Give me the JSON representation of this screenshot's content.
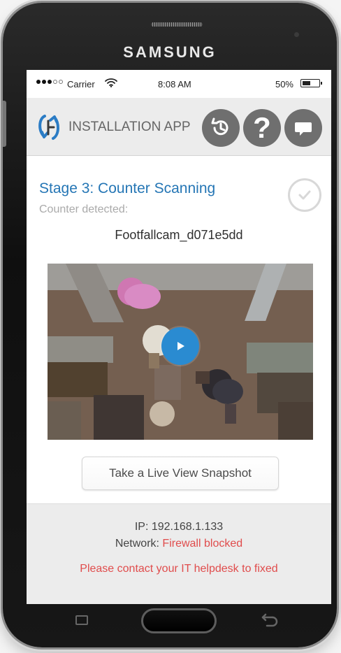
{
  "device": {
    "brand": "SAMSUNG"
  },
  "status_bar": {
    "carrier": "Carrier",
    "time": "8:08 AM",
    "battery": "50%"
  },
  "header": {
    "title": "INSTALLATION APP",
    "icons": {
      "app": "sync-logo-icon",
      "history": "history-icon",
      "help": "help-icon",
      "chat": "chat-icon"
    }
  },
  "main": {
    "stage_title": "Stage 3: Counter Scanning",
    "stage_subtitle": "Counter detected:",
    "device_name": "Footfallcam_d071e5dd",
    "snapshot_button": "Take a Live View Snapshot"
  },
  "footer": {
    "ip": "IP: 192.168.1.133",
    "network_label": "Network:",
    "network_value": "Firewall blocked",
    "help_text": "Please contact your IT helpdesk to fixed"
  },
  "colors": {
    "accent": "#2576b5",
    "error": "#e04c4c",
    "header_bg": "#ececec",
    "icon_bg": "#6f6f6f",
    "play_button": "#2a8bd1"
  }
}
